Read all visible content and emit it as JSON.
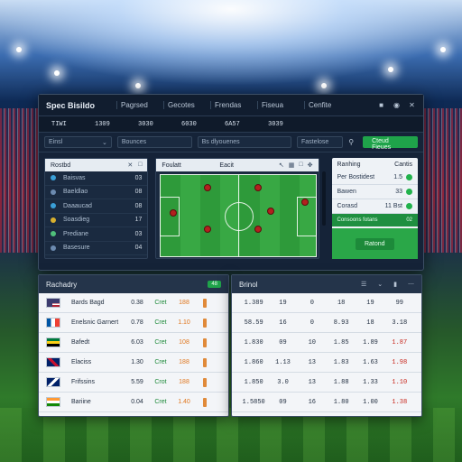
{
  "app": {
    "brand": "Spec Bisildo",
    "nav": [
      "Pagrsed",
      "Gecotes",
      "Frendas",
      "Fiseua",
      "Cenfite"
    ]
  },
  "stats": [
    "TIWI",
    "1309",
    "3030",
    "6030",
    "6A57",
    "3039"
  ],
  "filters": {
    "select1": "Einsl",
    "select2": "Bounces",
    "select3": "Bs dlyouenes",
    "select4": "Fastelose",
    "button": "Cteud Fieues"
  },
  "left_panel": {
    "title": "Rostbd",
    "rows": [
      {
        "name": "Baisvas",
        "value": "03",
        "color": "#3aa0d8"
      },
      {
        "name": "Baeldlao",
        "value": "08",
        "color": "#6c8bb0"
      },
      {
        "name": "Daaaucad",
        "value": "08",
        "color": "#3aa0d8"
      },
      {
        "name": "Soasdieg",
        "value": "17",
        "color": "#d8b02e"
      },
      {
        "name": "Prediane",
        "value": "03",
        "color": "#4fc07a"
      },
      {
        "name": "Basesure",
        "value": "04",
        "color": "#6c8bb0"
      }
    ]
  },
  "pitch_panel": {
    "tab1": "Foulatt",
    "tab2": "Eacit"
  },
  "right_panel": {
    "title": "Ranhing",
    "subtitle": "Cantis",
    "rows": [
      {
        "key": "Per Bostidest",
        "value": "1.5"
      },
      {
        "key": "Bawen",
        "value": "33"
      },
      {
        "key": "Corasd",
        "value": "11 Bst"
      }
    ],
    "strip_key": "Consoons fotans",
    "strip_value": "02",
    "button": "Ratond"
  },
  "table_left": {
    "title": "Rachadry",
    "badge": "48",
    "rows": [
      {
        "name": "Bards Bagd",
        "c1": "0.38",
        "c2": "Cret",
        "c3": "188"
      },
      {
        "name": "Enelsnic Garnert",
        "c1": "0.78",
        "c2": "Cret",
        "c3": "1.10"
      },
      {
        "name": "Bafedt",
        "c1": "6.03",
        "c2": "Cret",
        "c3": "108"
      },
      {
        "name": "Elaciss",
        "c1": "1.30",
        "c2": "Cret",
        "c3": "188"
      },
      {
        "name": "Frifssins",
        "c1": "5.59",
        "c2": "Crot",
        "c3": "188"
      },
      {
        "name": "Bariine",
        "c1": "0.04",
        "c2": "Cret",
        "c3": "1.40"
      }
    ]
  },
  "table_right": {
    "title": "Brinol",
    "rows": [
      [
        "1.389",
        "19",
        "0",
        "18",
        "19",
        "99"
      ],
      [
        "58.59",
        "16",
        "0",
        "8.93",
        "18",
        "3.18"
      ],
      [
        "1.830",
        "09",
        "10",
        "1.85",
        "1.89",
        "1.87"
      ],
      [
        "1.860",
        "1.13",
        "13",
        "1.83",
        "1.63",
        "1.98"
      ],
      [
        "1.850",
        "3.0",
        "13",
        "1.88",
        "1.33",
        "1.10"
      ],
      [
        "1.5850",
        "09",
        "16",
        "1.80",
        "1.00",
        "1.38"
      ]
    ]
  },
  "colors": {
    "accent_green": "#1fa34a",
    "panel_dark": "#152338",
    "player_red": "#b3201e"
  }
}
